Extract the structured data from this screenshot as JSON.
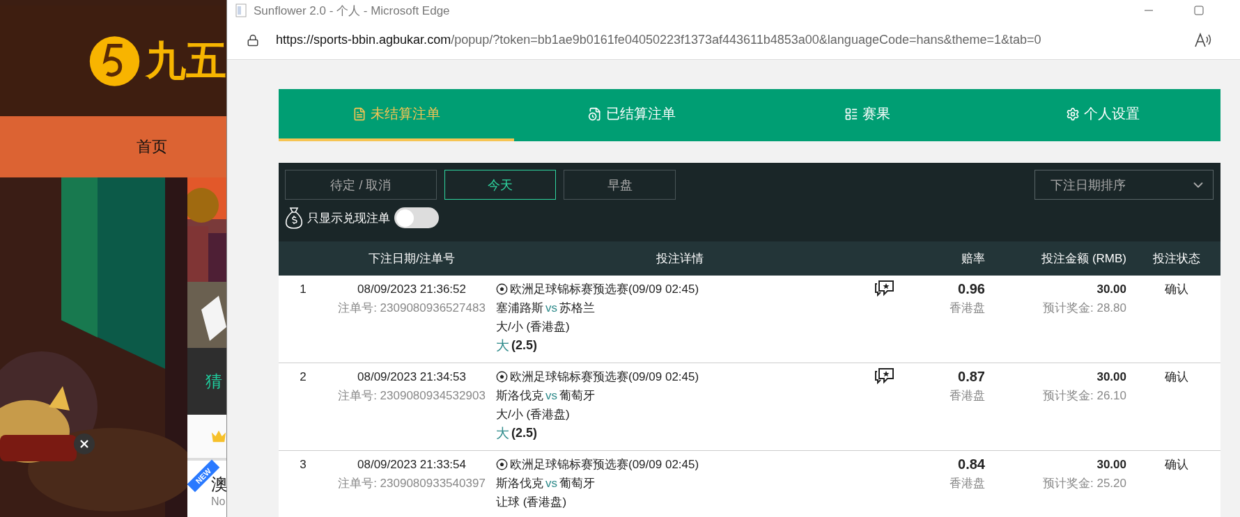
{
  "background_page": {
    "logo_text": "九五",
    "nav": [
      {
        "label": "首页"
      }
    ],
    "tiles": [
      {
        "label": "猜"
      }
    ],
    "new_card": {
      "badge": "NEW",
      "title": "澳",
      "subtitle": "No"
    }
  },
  "window": {
    "title": "Sunflower 2.0 - 个人 - Microsoft Edge",
    "url_host": "https://sports-bbin.agbukar.com",
    "url_rest": "/popup/?token=bb1ae9b0161fe04050223f1373af443611b4853a00&languageCode=hans&theme=1&tab=0"
  },
  "tabs": [
    {
      "kind": "open",
      "label": "未结算注单",
      "selected": true
    },
    {
      "kind": "settled",
      "label": "已结算注单",
      "selected": false
    },
    {
      "kind": "results",
      "label": "赛果",
      "selected": false
    },
    {
      "kind": "settings",
      "label": "个人设置",
      "selected": false
    }
  ],
  "filters": [
    {
      "label": "待定 / 取消",
      "selected": false
    },
    {
      "label": "今天",
      "selected": true
    },
    {
      "label": "早盘",
      "selected": false
    }
  ],
  "sort_select": {
    "value": "下注日期排序"
  },
  "cashout_toggle": {
    "label": "只显示兑现注单",
    "on": false
  },
  "table": {
    "columns": [
      "下注日期/注单号",
      "投注详情",
      "赔率",
      "投注金额 (RMB)",
      "投注状态"
    ],
    "rows": [
      {
        "index": "1",
        "date": "08/09/2023 21:36:52",
        "ticket": "注单号: 2309080936527483",
        "league": "欧洲足球锦标赛预选赛(09/09 02:45)",
        "home": "塞浦路斯",
        "vs": "vs",
        "away": "苏格兰",
        "market": "大/小 (香港盘)",
        "pick": "大",
        "line": "(2.5)",
        "chat": true,
        "odds": "0.96",
        "odds_type": "香港盘",
        "stake": "30.00",
        "payout": "预计奖金: 28.80",
        "status": "确认"
      },
      {
        "index": "2",
        "date": "08/09/2023 21:34:53",
        "ticket": "注单号: 2309080934532903",
        "league": "欧洲足球锦标赛预选赛(09/09 02:45)",
        "home": "斯洛伐克",
        "vs": "vs",
        "away": "葡萄牙",
        "market": "大/小 (香港盘)",
        "pick": "大",
        "line": "(2.5)",
        "chat": true,
        "odds": "0.87",
        "odds_type": "香港盘",
        "stake": "30.00",
        "payout": "预计奖金: 26.10",
        "status": "确认"
      },
      {
        "index": "3",
        "date": "08/09/2023 21:33:54",
        "ticket": "注单号: 2309080933540397",
        "league": "欧洲足球锦标赛预选赛(09/09 02:45)",
        "home": "斯洛伐克",
        "vs": "vs",
        "away": "葡萄牙",
        "market": "让球 (香港盘)",
        "chat": false,
        "odds": "0.84",
        "odds_type": "香港盘",
        "stake": "30.00",
        "payout": "预计奖金: 25.20",
        "status": "确认"
      }
    ]
  }
}
